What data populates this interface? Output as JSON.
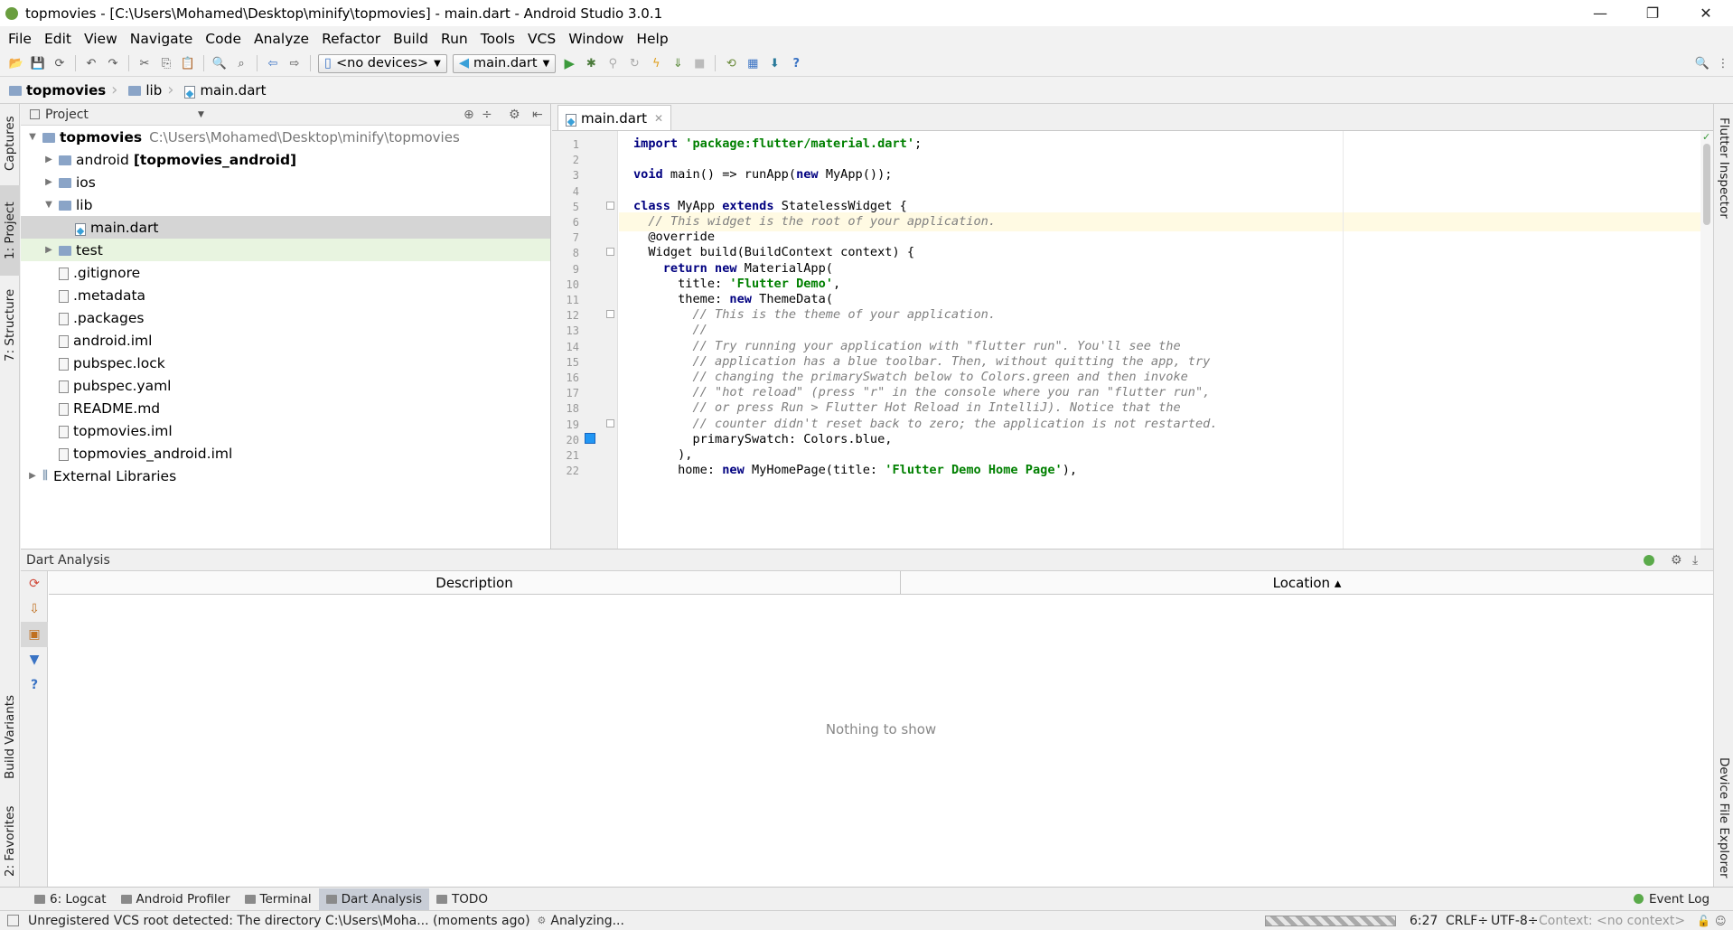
{
  "window": {
    "title": "topmovies - [C:\\Users\\Mohamed\\Desktop\\minify\\topmovies] - main.dart - Android Studio 3.0.1",
    "minimize": "—",
    "restore": "❐",
    "close": "✕"
  },
  "menu": [
    "File",
    "Edit",
    "View",
    "Navigate",
    "Code",
    "Analyze",
    "Refactor",
    "Build",
    "Run",
    "Tools",
    "VCS",
    "Window",
    "Help"
  ],
  "toolbar": {
    "device_combo": "<no devices>",
    "config_combo": "main.dart",
    "help": "?"
  },
  "breadcrumb": [
    "topmovies",
    "lib",
    "main.dart"
  ],
  "left_tabs": [
    "Captures",
    "1: Project",
    "7: Structure",
    "Build Variants",
    "2: Favorites"
  ],
  "right_tabs": [
    "Flutter Inspector",
    "Device File Explorer"
  ],
  "project": {
    "header": "Project",
    "tree": [
      {
        "label": "topmovies",
        "extra": "C:\\Users\\Mohamed\\Desktop\\minify\\topmovies",
        "bold": true,
        "arrow": "▼",
        "icon": "folder",
        "indent": 0
      },
      {
        "label": "android",
        "extra": "[topmovies_android]",
        "arrow": "▶",
        "icon": "folder",
        "indent": 1
      },
      {
        "label": "ios",
        "arrow": "▶",
        "icon": "folder",
        "indent": 1
      },
      {
        "label": "lib",
        "arrow": "▼",
        "icon": "folder",
        "indent": 1
      },
      {
        "label": "main.dart",
        "icon": "dart",
        "indent": 2,
        "selected": true
      },
      {
        "label": "test",
        "arrow": "▶",
        "icon": "folder",
        "indent": 1,
        "test": true
      },
      {
        "label": ".gitignore",
        "icon": "file",
        "indent": 1
      },
      {
        "label": ".metadata",
        "icon": "file",
        "indent": 1
      },
      {
        "label": ".packages",
        "icon": "file",
        "indent": 1
      },
      {
        "label": "android.iml",
        "icon": "file",
        "indent": 1
      },
      {
        "label": "pubspec.lock",
        "icon": "file",
        "indent": 1
      },
      {
        "label": "pubspec.yaml",
        "icon": "file",
        "indent": 1
      },
      {
        "label": "README.md",
        "icon": "file",
        "indent": 1
      },
      {
        "label": "topmovies.iml",
        "icon": "file",
        "indent": 1
      },
      {
        "label": "topmovies_android.iml",
        "icon": "file",
        "indent": 1
      },
      {
        "label": "External Libraries",
        "arrow": "▶",
        "icon": "lib",
        "indent": 0
      }
    ]
  },
  "editor": {
    "tab": "main.dart",
    "lines": [
      {
        "n": "1",
        "parts": [
          [
            "kw",
            "import "
          ],
          [
            "str",
            "'package:flutter/material.dart'"
          ],
          [
            "",
            "; "
          ]
        ]
      },
      {
        "n": "2",
        "parts": []
      },
      {
        "n": "3",
        "parts": [
          [
            "kw",
            "void "
          ],
          [
            "",
            "main() => runApp("
          ],
          [
            "kw",
            "new "
          ],
          [
            "",
            "MyApp());"
          ]
        ]
      },
      {
        "n": "4",
        "parts": []
      },
      {
        "n": "5",
        "parts": [
          [
            "kw",
            "class "
          ],
          [
            "",
            "MyApp "
          ],
          [
            "kw",
            "extends "
          ],
          [
            "",
            "StatelessWidget {"
          ]
        ]
      },
      {
        "n": "6",
        "parts": [
          [
            "cm",
            "  // This widget is the root of your application."
          ]
        ]
      },
      {
        "n": "7",
        "parts": [
          [
            "",
            "  @override"
          ]
        ]
      },
      {
        "n": "8",
        "parts": [
          [
            "",
            "  Widget build(BuildContext context) {"
          ]
        ]
      },
      {
        "n": "9",
        "parts": [
          [
            "kw",
            "    return new "
          ],
          [
            "",
            "MaterialApp("
          ]
        ]
      },
      {
        "n": "10",
        "parts": [
          [
            "",
            "      title: "
          ],
          [
            "str",
            "'Flutter Demo'"
          ],
          [
            "",
            ","
          ]
        ]
      },
      {
        "n": "11",
        "parts": [
          [
            "",
            "      theme: "
          ],
          [
            "kw",
            "new "
          ],
          [
            "",
            "ThemeData("
          ]
        ]
      },
      {
        "n": "12",
        "parts": [
          [
            "cm",
            "        // This is the theme of your application."
          ]
        ]
      },
      {
        "n": "13",
        "parts": [
          [
            "cm",
            "        //"
          ]
        ]
      },
      {
        "n": "14",
        "parts": [
          [
            "cm",
            "        // Try running your application with \"flutter run\". You'll see the"
          ]
        ]
      },
      {
        "n": "15",
        "parts": [
          [
            "cm",
            "        // application has a blue toolbar. Then, without quitting the app, try"
          ]
        ]
      },
      {
        "n": "16",
        "parts": [
          [
            "cm",
            "        // changing the primarySwatch below to Colors.green and then invoke"
          ]
        ]
      },
      {
        "n": "17",
        "parts": [
          [
            "cm",
            "        // \"hot reload\" (press \"r\" in the console where you ran \"flutter run\","
          ]
        ]
      },
      {
        "n": "18",
        "parts": [
          [
            "cm",
            "        // or press Run > Flutter Hot Reload in IntelliJ). Notice that the"
          ]
        ]
      },
      {
        "n": "19",
        "parts": [
          [
            "cm",
            "        // counter didn't reset back to zero; the application is not restarted."
          ]
        ]
      },
      {
        "n": "20",
        "parts": [
          [
            "",
            "        primarySwatch: Colors.blue,"
          ]
        ]
      },
      {
        "n": "21",
        "parts": [
          [
            "",
            "      ),"
          ]
        ]
      },
      {
        "n": "22",
        "parts": [
          [
            "",
            "      home: "
          ],
          [
            "kw",
            "new "
          ],
          [
            "",
            "MyHomePage(title: "
          ],
          [
            "str",
            "'Flutter Demo Home Page'"
          ],
          [
            "",
            "),"
          ]
        ]
      }
    ]
  },
  "analysis": {
    "title": "Dart Analysis",
    "col_description": "Description",
    "col_location": "Location ▴",
    "empty": "Nothing to show"
  },
  "toolwindows": [
    {
      "label": "6: Logcat",
      "active": false
    },
    {
      "label": "Android Profiler",
      "active": false
    },
    {
      "label": "Terminal",
      "active": false
    },
    {
      "label": "Dart Analysis",
      "active": true
    },
    {
      "label": "TODO",
      "active": false
    }
  ],
  "event_log": "Event Log",
  "status": {
    "message": "Unregistered VCS root detected: The directory C:\\Users\\Moha... (moments ago)",
    "analyzing": "Analyzing...",
    "position": "6:27",
    "line_sep": "CRLF÷",
    "encoding": "UTF-8÷",
    "context": "Context: <no context>"
  },
  "colors": {
    "keyword": "#000080",
    "string": "#008000",
    "comment": "#808080",
    "selection": "#d5d5d5",
    "caret_line": "#fffae3"
  }
}
